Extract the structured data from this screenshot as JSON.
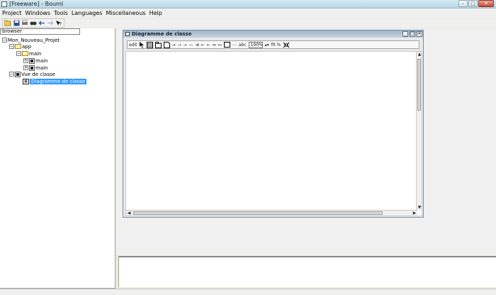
{
  "window": {
    "title": "[Freeware] - Bouml",
    "controls": [
      "–",
      "□",
      "✕"
    ]
  },
  "menu": {
    "items": [
      "Project",
      "Windows",
      "Tools",
      "Languages",
      "Miscellaneous",
      "Help"
    ]
  },
  "toolbar": {
    "icons": [
      "open-folder-icon",
      "save-icon",
      "print-icon",
      "search-binoculars-icon",
      "back-arrow-icon",
      "forward-arrow-icon",
      "what-is-this-icon"
    ]
  },
  "browser": {
    "header": "browser",
    "tree": [
      {
        "label": "Mon_Nouveau_Projet",
        "type": "project"
      },
      {
        "label": "app",
        "type": "package"
      },
      {
        "label": "main",
        "type": "package"
      },
      {
        "label": "main",
        "type": "class"
      },
      {
        "label": "main",
        "type": "class"
      },
      {
        "label": "Vue de classe",
        "type": "class-view"
      },
      {
        "label": "Diagramme de classe",
        "type": "diagram",
        "selected": true
      }
    ]
  },
  "diagram_window": {
    "title": "Diagramme de classe",
    "controls": [
      "_",
      "□",
      "✕"
    ],
    "toolbar": {
      "edit_label": "edit",
      "zoom_value": "100%",
      "fit_label": "fit %"
    }
  }
}
